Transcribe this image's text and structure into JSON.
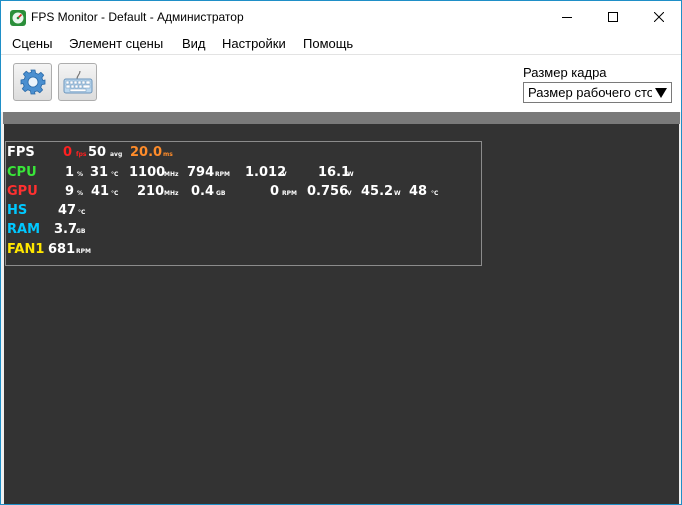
{
  "window": {
    "title": "FPS Monitor - Default - Администратор"
  },
  "menu": {
    "items": [
      "Сцены",
      "Элемент сцены",
      "Вид",
      "Настройки",
      "Помощь"
    ]
  },
  "toolbar": {
    "settings_icon": "gear-icon",
    "keyboard_icon": "keyboard-icon",
    "frame_size_label": "Размер кадра",
    "frame_size_value": "Размер рабочего стола"
  },
  "colors": {
    "fps": "#ffffff",
    "cpu": "#39e639",
    "gpu": "#ff3030",
    "hs": "#00c8ff",
    "ram": "#00c8ff",
    "fan": "#ffe600",
    "fps_value": "#ff2020",
    "frametime": "#ff8c2a",
    "canvas_bg": "#333333"
  },
  "overlay": {
    "fps": {
      "label": "FPS",
      "value": "0",
      "unit": "fps",
      "avg": "50",
      "avg_unit": "avg",
      "frametime": "20.0",
      "frametime_unit": "ms"
    },
    "cpu": {
      "label": "CPU",
      "load": "1",
      "load_unit": "%",
      "temp": "31",
      "temp_unit": "°C",
      "clock": "1100",
      "clock_unit": "MHz",
      "fan": "794",
      "fan_unit": "RPM",
      "voltage": "1.012",
      "voltage_unit": "V",
      "power": "16.1",
      "power_unit": "W"
    },
    "gpu": {
      "label": "GPU",
      "load": "9",
      "load_unit": "%",
      "temp": "41",
      "temp_unit": "°C",
      "clock": "210",
      "clock_unit": "MHz",
      "mem": "0.4",
      "mem_unit": "GB",
      "fan": "0",
      "fan_unit": "RPM",
      "voltage": "0.756",
      "voltage_unit": "V",
      "power": "45.2",
      "power_unit": "W",
      "hotspot": "48",
      "hotspot_unit": "°C"
    },
    "hs": {
      "label": "HS",
      "temp": "47",
      "temp_unit": "°C"
    },
    "ram": {
      "label": "RAM",
      "used": "3.7",
      "used_unit": "GB"
    },
    "fan1": {
      "label": "FAN1",
      "speed": "681",
      "speed_unit": "RPM"
    }
  }
}
